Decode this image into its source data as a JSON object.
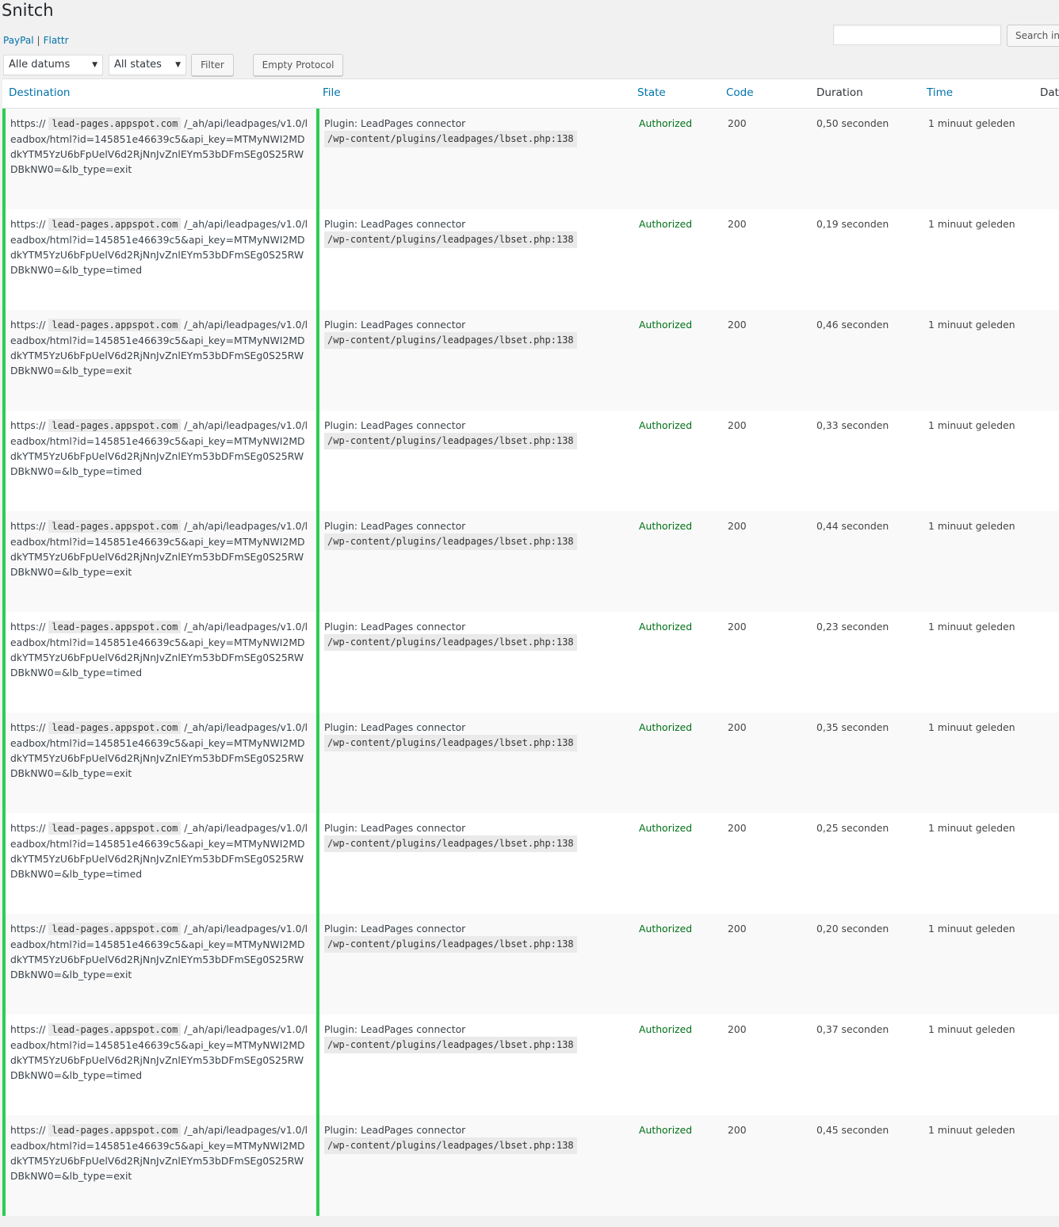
{
  "page": {
    "title": "Snitch"
  },
  "links": {
    "paypal": "PayPal",
    "separator": "|",
    "flattr": "Flattr"
  },
  "search": {
    "button": "Search in"
  },
  "filters": {
    "date_value": "Alle datums",
    "state_value": "All states",
    "filter_button": "Filter",
    "empty_button": "Empty Protocol"
  },
  "columns": {
    "destination": "Destination",
    "file": "File",
    "state": "State",
    "code": "Code",
    "duration": "Duration",
    "time": "Time",
    "date": "Dat"
  },
  "rows": [
    {
      "dest_prefix": "https://",
      "dest_host": "lead-pages.appspot.com",
      "dest_path": "/_ah/api/leadpages/v1.0/leadbox/html?id=145851e46639c5&api_key=MTMyNWI2MDdkYTM5YzU6bFpUelV6d2RjNnJvZnlEYm53bDFmSEg0S25RWDBkNW0=&lb_type=exit",
      "file_label": "Plugin: LeadPages connector",
      "file_path": "/wp-content/plugins/leadpages/lbset.php:138",
      "state": "Authorized",
      "code": "200",
      "duration": "0,50 seconden",
      "time": "1 minuut geleden"
    },
    {
      "dest_prefix": "https://",
      "dest_host": "lead-pages.appspot.com",
      "dest_path": "/_ah/api/leadpages/v1.0/leadbox/html?id=145851e46639c5&api_key=MTMyNWI2MDdkYTM5YzU6bFpUelV6d2RjNnJvZnlEYm53bDFmSEg0S25RWDBkNW0=&lb_type=timed",
      "file_label": "Plugin: LeadPages connector",
      "file_path": "/wp-content/plugins/leadpages/lbset.php:138",
      "state": "Authorized",
      "code": "200",
      "duration": "0,19 seconden",
      "time": "1 minuut geleden"
    },
    {
      "dest_prefix": "https://",
      "dest_host": "lead-pages.appspot.com",
      "dest_path": "/_ah/api/leadpages/v1.0/leadbox/html?id=145851e46639c5&api_key=MTMyNWI2MDdkYTM5YzU6bFpUelV6d2RjNnJvZnlEYm53bDFmSEg0S25RWDBkNW0=&lb_type=exit",
      "file_label": "Plugin: LeadPages connector",
      "file_path": "/wp-content/plugins/leadpages/lbset.php:138",
      "state": "Authorized",
      "code": "200",
      "duration": "0,46 seconden",
      "time": "1 minuut geleden"
    },
    {
      "dest_prefix": "https://",
      "dest_host": "lead-pages.appspot.com",
      "dest_path": "/_ah/api/leadpages/v1.0/leadbox/html?id=145851e46639c5&api_key=MTMyNWI2MDdkYTM5YzU6bFpUelV6d2RjNnJvZnlEYm53bDFmSEg0S25RWDBkNW0=&lb_type=timed",
      "file_label": "Plugin: LeadPages connector",
      "file_path": "/wp-content/plugins/leadpages/lbset.php:138",
      "state": "Authorized",
      "code": "200",
      "duration": "0,33 seconden",
      "time": "1 minuut geleden"
    },
    {
      "dest_prefix": "https://",
      "dest_host": "lead-pages.appspot.com",
      "dest_path": "/_ah/api/leadpages/v1.0/leadbox/html?id=145851e46639c5&api_key=MTMyNWI2MDdkYTM5YzU6bFpUelV6d2RjNnJvZnlEYm53bDFmSEg0S25RWDBkNW0=&lb_type=exit",
      "file_label": "Plugin: LeadPages connector",
      "file_path": "/wp-content/plugins/leadpages/lbset.php:138",
      "state": "Authorized",
      "code": "200",
      "duration": "0,44 seconden",
      "time": "1 minuut geleden"
    },
    {
      "dest_prefix": "https://",
      "dest_host": "lead-pages.appspot.com",
      "dest_path": "/_ah/api/leadpages/v1.0/leadbox/html?id=145851e46639c5&api_key=MTMyNWI2MDdkYTM5YzU6bFpUelV6d2RjNnJvZnlEYm53bDFmSEg0S25RWDBkNW0=&lb_type=timed",
      "file_label": "Plugin: LeadPages connector",
      "file_path": "/wp-content/plugins/leadpages/lbset.php:138",
      "state": "Authorized",
      "code": "200",
      "duration": "0,23 seconden",
      "time": "1 minuut geleden"
    },
    {
      "dest_prefix": "https://",
      "dest_host": "lead-pages.appspot.com",
      "dest_path": "/_ah/api/leadpages/v1.0/leadbox/html?id=145851e46639c5&api_key=MTMyNWI2MDdkYTM5YzU6bFpUelV6d2RjNnJvZnlEYm53bDFmSEg0S25RWDBkNW0=&lb_type=exit",
      "file_label": "Plugin: LeadPages connector",
      "file_path": "/wp-content/plugins/leadpages/lbset.php:138",
      "state": "Authorized",
      "code": "200",
      "duration": "0,35 seconden",
      "time": "1 minuut geleden"
    },
    {
      "dest_prefix": "https://",
      "dest_host": "lead-pages.appspot.com",
      "dest_path": "/_ah/api/leadpages/v1.0/leadbox/html?id=145851e46639c5&api_key=MTMyNWI2MDdkYTM5YzU6bFpUelV6d2RjNnJvZnlEYm53bDFmSEg0S25RWDBkNW0=&lb_type=timed",
      "file_label": "Plugin: LeadPages connector",
      "file_path": "/wp-content/plugins/leadpages/lbset.php:138",
      "state": "Authorized",
      "code": "200",
      "duration": "0,25 seconden",
      "time": "1 minuut geleden"
    },
    {
      "dest_prefix": "https://",
      "dest_host": "lead-pages.appspot.com",
      "dest_path": "/_ah/api/leadpages/v1.0/leadbox/html?id=145851e46639c5&api_key=MTMyNWI2MDdkYTM5YzU6bFpUelV6d2RjNnJvZnlEYm53bDFmSEg0S25RWDBkNW0=&lb_type=exit",
      "file_label": "Plugin: LeadPages connector",
      "file_path": "/wp-content/plugins/leadpages/lbset.php:138",
      "state": "Authorized",
      "code": "200",
      "duration": "0,20 seconden",
      "time": "1 minuut geleden"
    },
    {
      "dest_prefix": "https://",
      "dest_host": "lead-pages.appspot.com",
      "dest_path": "/_ah/api/leadpages/v1.0/leadbox/html?id=145851e46639c5&api_key=MTMyNWI2MDdkYTM5YzU6bFpUelV6d2RjNnJvZnlEYm53bDFmSEg0S25RWDBkNW0=&lb_type=timed",
      "file_label": "Plugin: LeadPages connector",
      "file_path": "/wp-content/plugins/leadpages/lbset.php:138",
      "state": "Authorized",
      "code": "200",
      "duration": "0,37 seconden",
      "time": "1 minuut geleden"
    },
    {
      "dest_prefix": "https://",
      "dest_host": "lead-pages.appspot.com",
      "dest_path": "/_ah/api/leadpages/v1.0/leadbox/html?id=145851e46639c5&api_key=MTMyNWI2MDdkYTM5YzU6bFpUelV6d2RjNnJvZnlEYm53bDFmSEg0S25RWDBkNW0=&lb_type=exit",
      "file_label": "Plugin: LeadPages connector",
      "file_path": "/wp-content/plugins/leadpages/lbset.php:138",
      "state": "Authorized",
      "code": "200",
      "duration": "0,45 seconden",
      "time": "1 minuut geleden"
    }
  ],
  "colors": {
    "accent": "#0073aa",
    "state_ok": "#007017",
    "status_bar": "#2ecc51"
  }
}
